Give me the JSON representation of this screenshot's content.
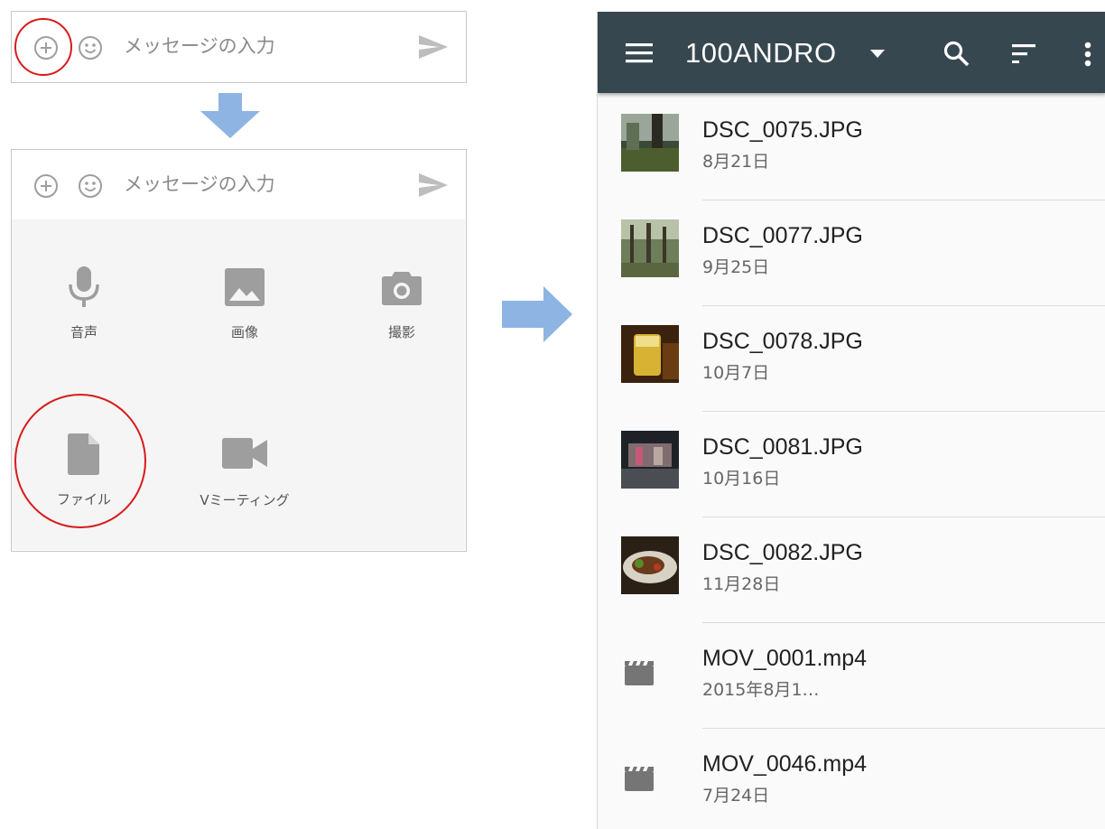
{
  "composer": {
    "placeholder": "メッセージの入力"
  },
  "attach_menu": {
    "items": [
      {
        "label": "音声",
        "icon": "microphone-icon"
      },
      {
        "label": "画像",
        "icon": "image-icon"
      },
      {
        "label": "撮影",
        "icon": "camera-icon"
      },
      {
        "label": "ファイル",
        "icon": "file-icon"
      },
      {
        "label": "Vミーティング",
        "icon": "videocam-icon"
      }
    ]
  },
  "file_picker": {
    "title": "100ANDRO",
    "toolbar_icons": [
      "menu-icon",
      "dropdown-icon",
      "search-icon",
      "sort-icon",
      "more-vert-icon"
    ],
    "appbar_color": "#37474f",
    "files": [
      {
        "name": "DSC_0075.JPG",
        "date": "8月21日",
        "type": "image"
      },
      {
        "name": "DSC_0077.JPG",
        "date": "9月25日",
        "type": "image"
      },
      {
        "name": "DSC_0078.JPG",
        "date": "10月7日",
        "type": "image"
      },
      {
        "name": "DSC_0081.JPG",
        "date": "10月16日",
        "type": "image"
      },
      {
        "name": "DSC_0082.JPG",
        "date": "11月28日",
        "type": "image"
      },
      {
        "name": "MOV_0001.mp4",
        "date": "2015年8月1…",
        "type": "video"
      },
      {
        "name": "MOV_0046.mp4",
        "date": "7月24日",
        "type": "video"
      }
    ]
  },
  "annotation_color": "#d81b1b",
  "arrow_color": "#8eb4e3"
}
